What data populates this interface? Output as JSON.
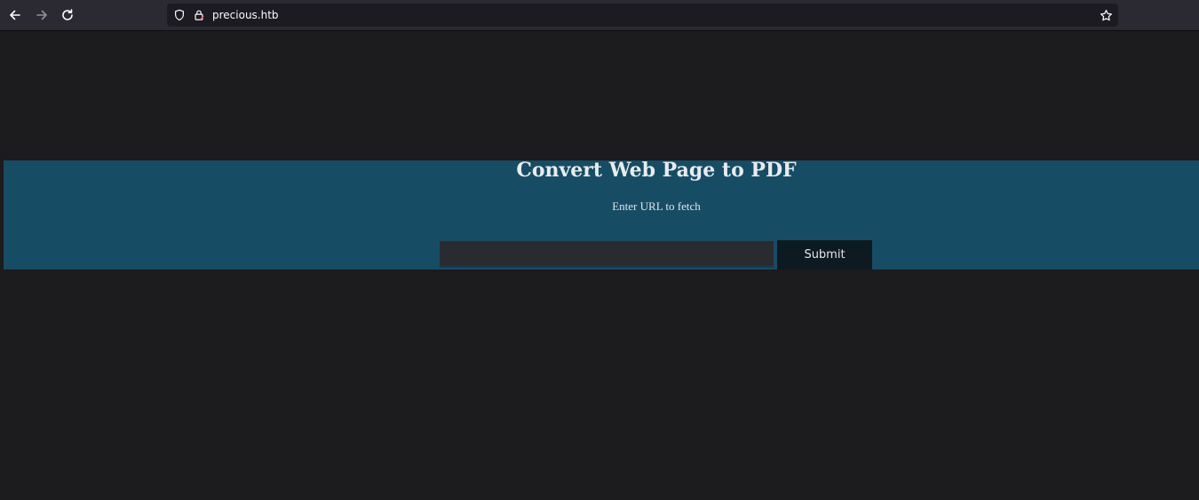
{
  "browser": {
    "url": "precious.htb",
    "icons": {
      "back": "arrow-left-icon",
      "forward": "arrow-right-icon",
      "reload": "reload-icon",
      "tracking": "shield-icon",
      "security": "lock-icon",
      "bookmark": "star-icon"
    }
  },
  "page": {
    "title": "Convert Web Page to PDF",
    "subtitle": "Enter URL to fetch",
    "url_input": {
      "value": "",
      "placeholder": ""
    },
    "submit_label": "Submit"
  },
  "colors": {
    "banner": "#174c65",
    "page_background": "#1c1b1d",
    "button_background": "#0e1a22"
  }
}
